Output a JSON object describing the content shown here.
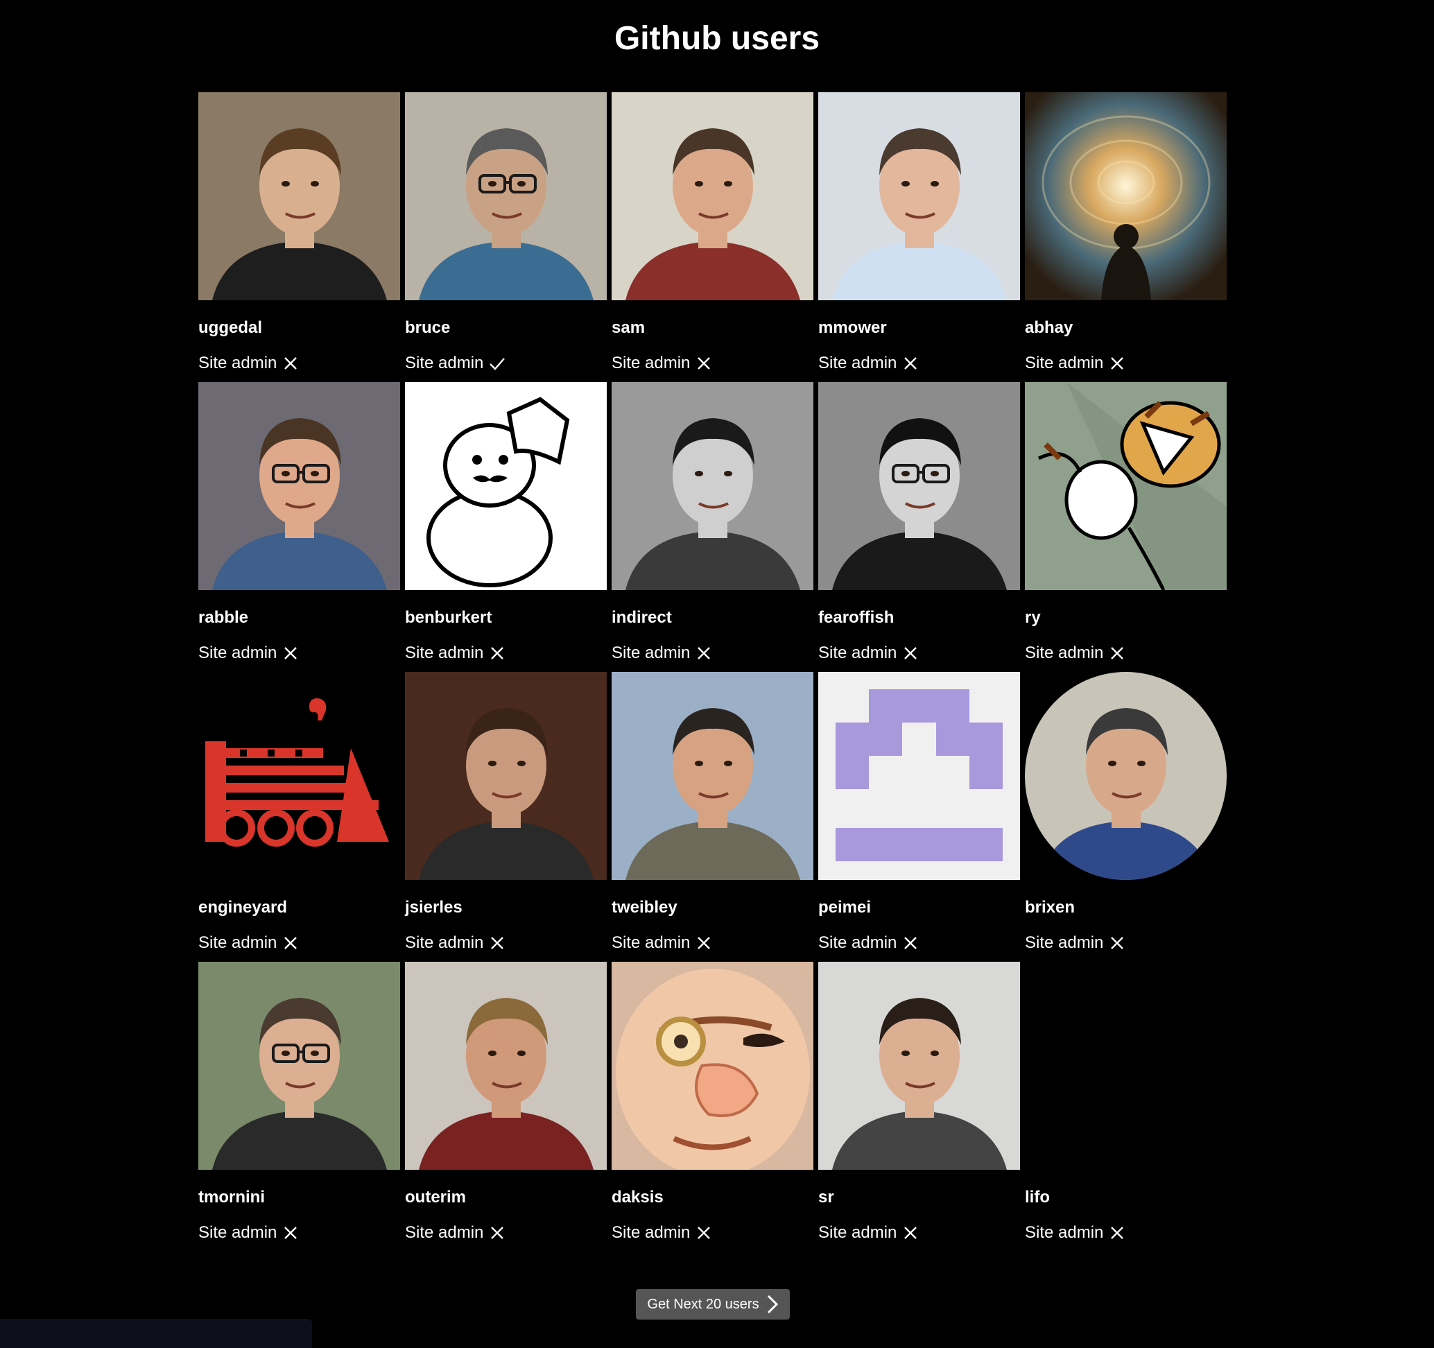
{
  "page": {
    "title": "Github users"
  },
  "users": [
    {
      "login": "uggedal",
      "site_admin_label": "Site admin",
      "site_admin": false,
      "avatar_style": "photo",
      "bg": "#8a7a66",
      "skin": "#d8b090",
      "hair": "#5a3d22",
      "shirt": "#1e1e1e",
      "glasses": false
    },
    {
      "login": "bruce",
      "site_admin_label": "Site admin",
      "site_admin": true,
      "avatar_style": "photo",
      "bg": "#b9b2a6",
      "skin": "#c9a184",
      "hair": "#5a5a5a",
      "shirt": "#3b6c92",
      "glasses": true
    },
    {
      "login": "sam",
      "site_admin_label": "Site admin",
      "site_admin": false,
      "avatar_style": "photo",
      "bg": "#d9d4c8",
      "skin": "#dba98a",
      "hair": "#4a3628",
      "shirt": "#8a2f2a",
      "glasses": false
    },
    {
      "login": "mmower",
      "site_admin_label": "Site admin",
      "site_admin": false,
      "avatar_style": "photo",
      "bg": "#d8dde3",
      "skin": "#e2b79c",
      "hair": "#4a3a30",
      "shirt": "#cfe0f2",
      "glasses": false
    },
    {
      "login": "abhay",
      "site_admin_label": "Site admin",
      "site_admin": false,
      "avatar_style": "vortex",
      "bg": "#2a2418"
    },
    {
      "login": "rabble",
      "site_admin_label": "Site admin",
      "site_admin": false,
      "avatar_style": "photo",
      "bg": "#6d6a74",
      "skin": "#e0a88a",
      "hair": "#4a3424",
      "shirt": "#3f5f8c",
      "glasses": true
    },
    {
      "login": "benburkert",
      "site_admin_label": "Site admin",
      "site_admin": false,
      "avatar_style": "snowman",
      "bg": "#ffffff"
    },
    {
      "login": "indirect",
      "site_admin_label": "Site admin",
      "site_admin": false,
      "avatar_style": "photo",
      "bg": "#9a9a9a",
      "skin": "#cfcfcf",
      "hair": "#1a1a1a",
      "shirt": "#3a3a3a",
      "glasses": false
    },
    {
      "login": "fearoffish",
      "site_admin_label": "Site admin",
      "site_admin": false,
      "avatar_style": "photo",
      "bg": "#8c8c8c",
      "skin": "#d4d4d4",
      "hair": "#111111",
      "shirt": "#1a1a1a",
      "glasses": true
    },
    {
      "login": "ry",
      "site_admin_label": "Site admin",
      "site_admin": false,
      "avatar_style": "tiger",
      "bg": "#8fa08c"
    },
    {
      "login": "engineyard",
      "site_admin_label": "Site admin",
      "site_admin": false,
      "avatar_style": "train",
      "bg": "#000000"
    },
    {
      "login": "jsierles",
      "site_admin_label": "Site admin",
      "site_admin": false,
      "avatar_style": "photo",
      "bg": "#4a2a1e",
      "skin": "#c99a7e",
      "hair": "#3a2418",
      "shirt": "#2a2a2a",
      "glasses": false
    },
    {
      "login": "tweibley",
      "site_admin_label": "Site admin",
      "site_admin": false,
      "avatar_style": "photo",
      "bg": "#9bb0c6",
      "skin": "#d6a282",
      "hair": "#2a2420",
      "shirt": "#6e6a5a",
      "glasses": false
    },
    {
      "login": "peimei",
      "site_admin_label": "Site admin",
      "site_admin": false,
      "avatar_style": "identicon",
      "bg": "#f0f0f0",
      "fg": "#a898dc"
    },
    {
      "login": "brixen",
      "site_admin_label": "Site admin",
      "site_admin": false,
      "avatar_style": "photo-round",
      "bg": "#c8c4b8",
      "skin": "#d8a88a",
      "hair": "#3a3a3a",
      "shirt": "#2e4a8a",
      "glasses": false
    },
    {
      "login": "tmornini",
      "site_admin_label": "Site admin",
      "site_admin": false,
      "avatar_style": "photo",
      "bg": "#7a8a6a",
      "skin": "#dcae92",
      "hair": "#4a3a30",
      "shirt": "#2a2a2a",
      "glasses": true
    },
    {
      "login": "outerim",
      "site_admin_label": "Site admin",
      "site_admin": false,
      "avatar_style": "photo",
      "bg": "#cbc5bd",
      "skin": "#d09a7a",
      "hair": "#8a6a3a",
      "shirt": "#7a2222",
      "glasses": false
    },
    {
      "login": "daksis",
      "site_admin_label": "Site admin",
      "site_admin": false,
      "avatar_style": "cartoon",
      "bg": "#d8b8a0"
    },
    {
      "login": "sr",
      "site_admin_label": "Site admin",
      "site_admin": false,
      "avatar_style": "photo",
      "bg": "#d8d8d6",
      "skin": "#dcae92",
      "hair": "#2a1e18",
      "shirt": "#444444",
      "glasses": false
    },
    {
      "login": "lifo",
      "site_admin_label": "Site admin",
      "site_admin": false,
      "avatar_style": "empty",
      "bg": "#000000"
    }
  ],
  "pagination": {
    "next_label": "Get Next 20 users"
  },
  "colors": {
    "background": "#000000",
    "text": "#ffffff",
    "button_bg": "#555555"
  }
}
